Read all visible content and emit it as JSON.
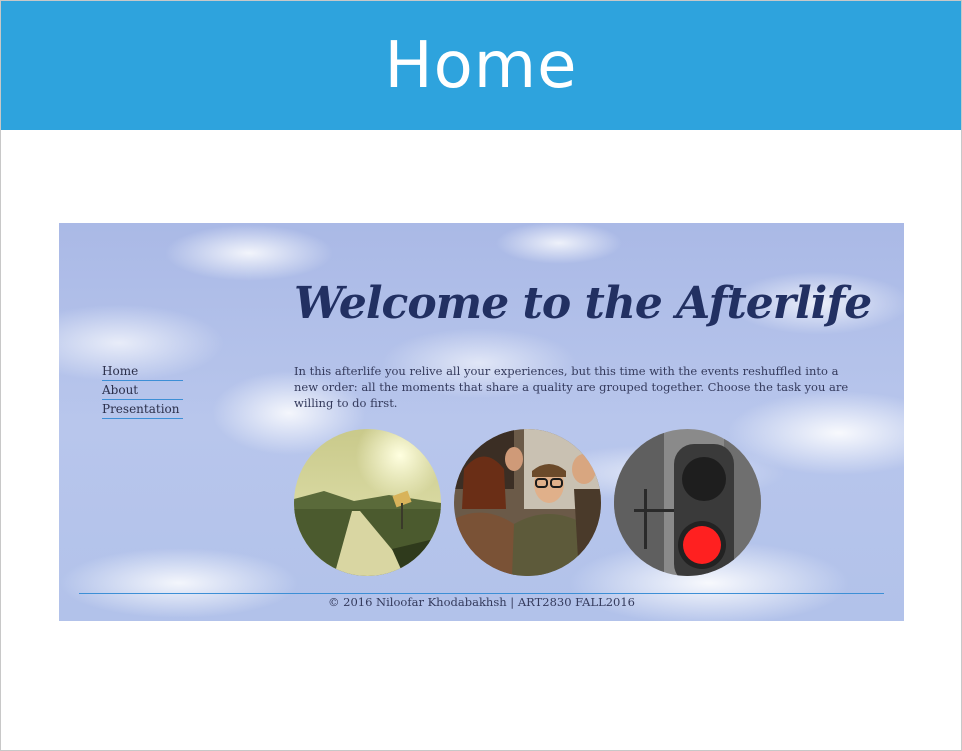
{
  "slide": {
    "title": "Home"
  },
  "site": {
    "heading": "Welcome to the Afterlife",
    "nav": {
      "items": [
        "Home",
        "About",
        "Presentation"
      ]
    },
    "intro": "In this afterlife you relive all your experiences, but this time with the events reshuffled into a new order: all the moments that share a quality are grouped together. Choose the task you are willing to do first.",
    "images": [
      {
        "name": "road-image"
      },
      {
        "name": "crowd-image"
      },
      {
        "name": "traffic-light-image"
      }
    ],
    "footer": "© 2016 Niloofar Khodabakhsh | ART2830 FALL2016"
  },
  "colors": {
    "title_bar": "#2ea3dd",
    "heading": "#223062",
    "nav_underline": "#3d8fd6",
    "traffic_red": "#ff2020"
  }
}
